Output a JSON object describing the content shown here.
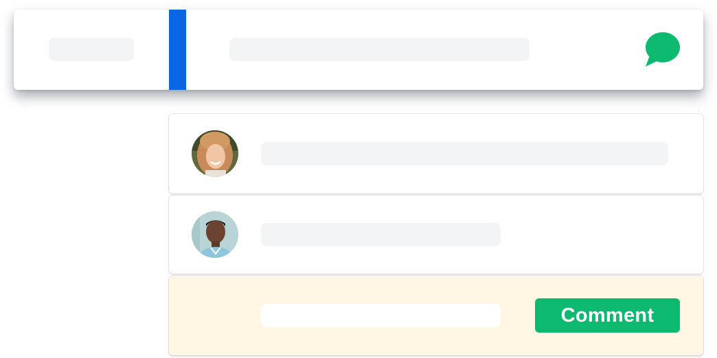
{
  "header": {
    "comment_icon": "speech-bubble-icon",
    "icon_color": "#0db96f",
    "cursor_color": "#0a66e4"
  },
  "comments": [
    {
      "avatar": "woman-avatar",
      "text": ""
    },
    {
      "avatar": "man-avatar",
      "text": ""
    }
  ],
  "compose": {
    "input_value": "",
    "placeholder": "",
    "button_label": "Comment",
    "background": "#fff7e3",
    "button_color": "#0db96f"
  }
}
